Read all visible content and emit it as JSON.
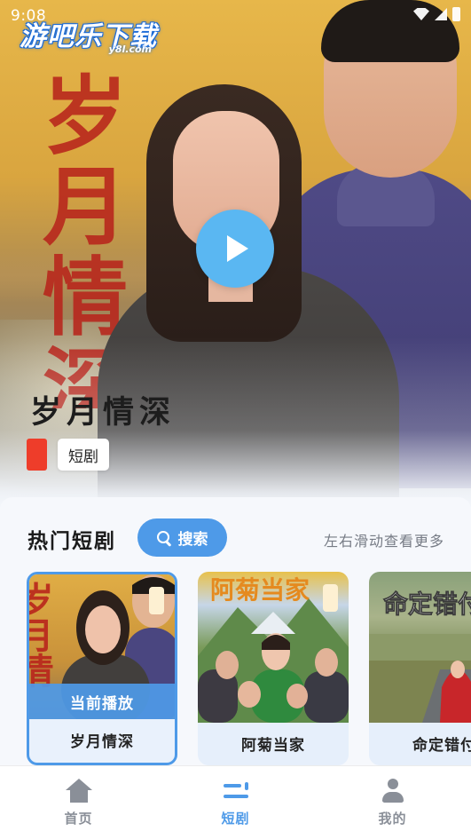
{
  "status_bar": {
    "time": "9:08"
  },
  "logo": {
    "text_cn": "游吧乐下载",
    "text_en": "y8l.com"
  },
  "hero": {
    "poster_calligraphy": "岁月情深",
    "title": "岁月情深",
    "genre_tag": "短剧"
  },
  "hot_section": {
    "title": "热门短剧",
    "search_label": "搜索",
    "swipe_hint": "左右滑动查看更多",
    "now_playing_label": "当前播放",
    "cards": [
      {
        "name": "岁月情深",
        "poster_text": "岁月情",
        "active": true
      },
      {
        "name": "阿菊当家",
        "poster_text": "阿菊当家",
        "active": false
      },
      {
        "name": "命定错付",
        "poster_text": "命定错付",
        "active": false
      }
    ]
  },
  "tabbar": {
    "items": [
      {
        "label": "首页",
        "icon": "home-icon",
        "active": false
      },
      {
        "label": "短剧",
        "icon": "drama-icon",
        "active": true
      },
      {
        "label": "我的",
        "icon": "user-icon",
        "active": false
      }
    ]
  },
  "colors": {
    "accent": "#4e9ae8",
    "play_button": "#5ab7f2",
    "tag_red": "#ee3d2a",
    "inactive_tab": "#8a8f98"
  }
}
